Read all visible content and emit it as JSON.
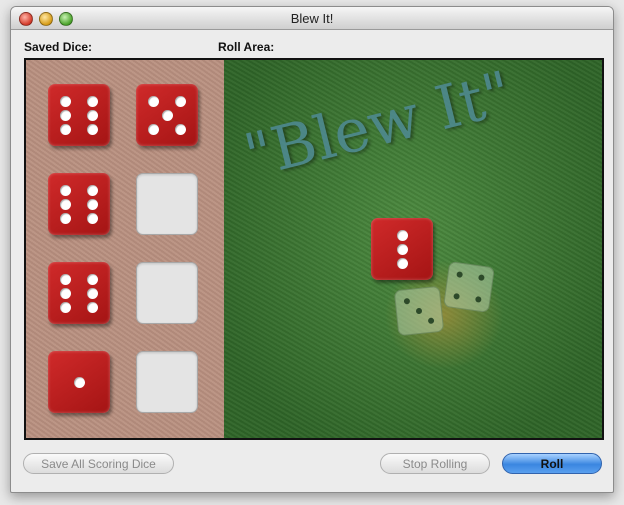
{
  "window": {
    "title": "Blew It!"
  },
  "labels": {
    "saved_dice": "Saved Dice:",
    "roll_area": "Roll Area:"
  },
  "roll_area": {
    "logo_text": "\"Blew It\""
  },
  "saved_dice": [
    {
      "value": 6,
      "filled": true
    },
    {
      "value": 5,
      "filled": true
    },
    {
      "value": 6,
      "filled": true
    },
    {
      "value": 0,
      "filled": false
    },
    {
      "value": 6,
      "filled": true
    },
    {
      "value": 0,
      "filled": false
    },
    {
      "value": 1,
      "filled": true
    },
    {
      "value": 0,
      "filled": false
    }
  ],
  "rolled_die": {
    "value": 3
  },
  "buttons": {
    "save_all": "Save All Scoring Dice",
    "stop_rolling": "Stop Rolling",
    "roll": "Roll"
  },
  "colors": {
    "die_red": "#c21f1f",
    "felt_green": "#3f7a34",
    "tray_tan": "#b99080",
    "default_button": "#3a86e0"
  }
}
